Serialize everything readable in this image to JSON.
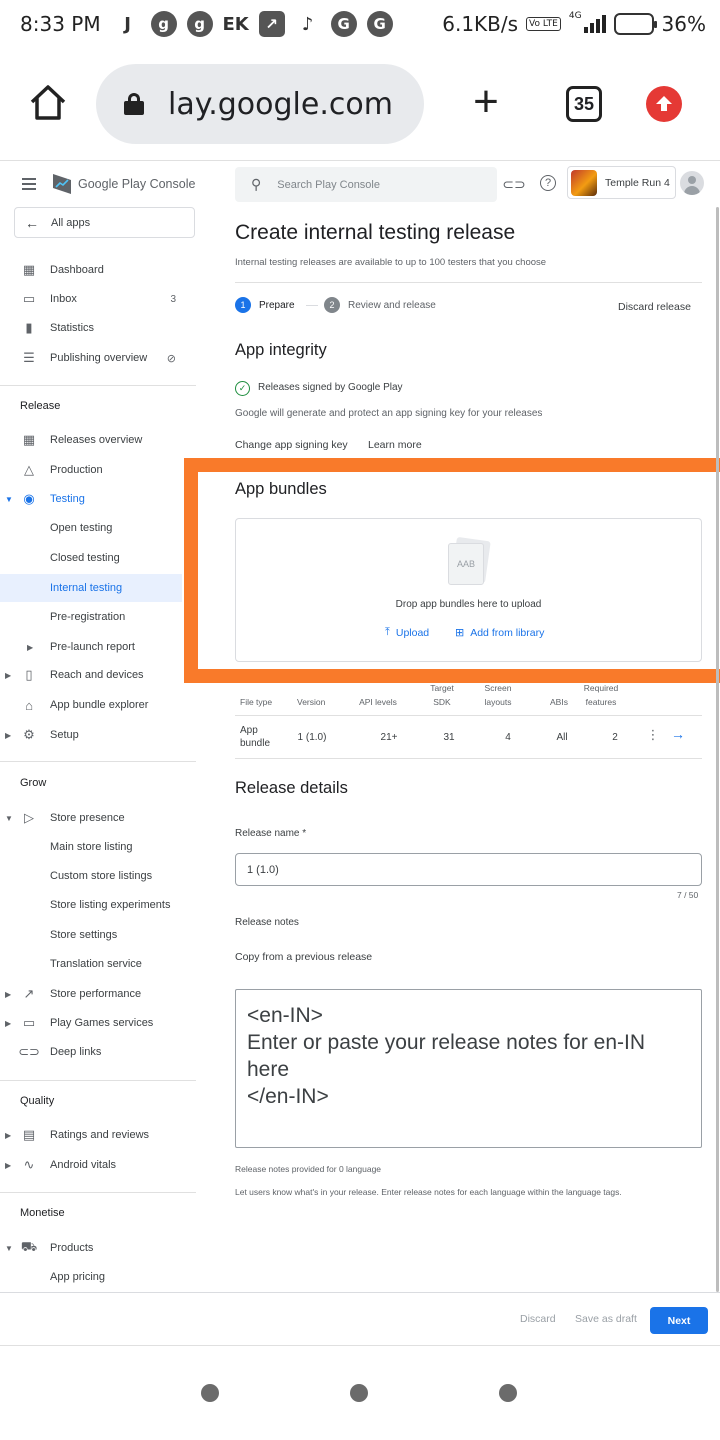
{
  "status_bar": {
    "time": "8:33 PM",
    "notif_icons": [
      "J",
      "g",
      "g",
      "EK",
      "↗",
      "♪",
      "G",
      "G"
    ],
    "speed": "6.1KB/s",
    "volte": "Vo LTE",
    "network": "4G",
    "battery": "36%",
    "battery_level": 0.36
  },
  "browser": {
    "url": "lay.google.com",
    "tab_count": "35"
  },
  "sidebar": {
    "brand": "Google Play Console",
    "all_apps": "All apps",
    "items_top": [
      {
        "label": "Dashboard",
        "icon": "dashboard-icon"
      },
      {
        "label": "Inbox",
        "icon": "inbox-icon",
        "badge": "3"
      },
      {
        "label": "Statistics",
        "icon": "statistics-icon"
      },
      {
        "label": "Publishing overview",
        "icon": "publishing-icon"
      }
    ],
    "release_label": "Release",
    "release_items": [
      {
        "label": "Releases overview"
      },
      {
        "label": "Production"
      },
      {
        "label": "Testing"
      },
      {
        "label": "Open testing"
      },
      {
        "label": "Closed testing"
      },
      {
        "label": "Internal testing"
      },
      {
        "label": "Pre-registration"
      },
      {
        "label": "Pre-launch report"
      },
      {
        "label": "Reach and devices"
      },
      {
        "label": "App bundle explorer"
      },
      {
        "label": "Setup"
      }
    ],
    "grow_label": "Grow",
    "grow_items": [
      {
        "label": "Store presence"
      },
      {
        "label": "Main store listing"
      },
      {
        "label": "Custom store listings"
      },
      {
        "label": "Store listing experiments"
      },
      {
        "label": "Store settings"
      },
      {
        "label": "Translation service"
      },
      {
        "label": "Store performance"
      },
      {
        "label": "Play Games services"
      },
      {
        "label": "Deep links"
      }
    ],
    "quality_label": "Quality",
    "quality_items": [
      {
        "label": "Ratings and reviews"
      },
      {
        "label": "Android vitals"
      }
    ],
    "monetise_label": "Monetise",
    "monetise_items": [
      {
        "label": "Products"
      },
      {
        "label": "App pricing"
      }
    ]
  },
  "topbar": {
    "search_placeholder": "Search Play Console",
    "app_name": "Temple Run 4"
  },
  "main": {
    "title": "Create internal testing release",
    "subtitle": "Internal testing releases are available to up to 100 testers that you choose",
    "steps": [
      {
        "num": "1",
        "label": "Prepare"
      },
      {
        "num": "2",
        "label": "Review and release"
      }
    ],
    "discard_release": "Discard release",
    "integrity": {
      "heading": "App integrity",
      "signed": "Releases signed by Google Play",
      "description": "Google will generate and protect an app signing key for your releases",
      "change_key": "Change app signing key",
      "learn_more": "Learn more"
    },
    "bundles": {
      "heading": "App bundles",
      "aab": "AAB",
      "drop_text": "Drop app bundles here to upload",
      "upload": "Upload",
      "add_library": "Add from library"
    },
    "table": {
      "headers": [
        "File type",
        "Version",
        "API levels",
        "Target SDK",
        "Screen layouts",
        "ABIs",
        "Required features"
      ],
      "row": [
        "App bundle",
        "1 (1.0)",
        "21+",
        "31",
        "4",
        "All",
        "2"
      ]
    },
    "release_details": {
      "heading": "Release details",
      "name_label": "Release name",
      "required_mark": "*",
      "name_value": "1 (1.0)",
      "counter": "7 / 50",
      "notes_label": "Release notes",
      "copy_prev": "Copy from a previous release",
      "notes_value": "<en-IN>\nEnter or paste your release notes for en-IN here\n</en-IN>",
      "notes_provided": "Release notes provided for 0 language",
      "notes_help": "Let users know what's in your release. Enter release notes for each language within the language tags."
    }
  },
  "footer": {
    "discard": "Discard",
    "save_draft": "Save as draft",
    "next": "Next"
  }
}
